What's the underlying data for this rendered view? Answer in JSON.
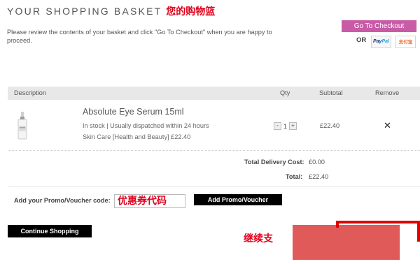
{
  "header": {
    "title": "YOUR SHOPPING BASKET",
    "title_cn": "您的购物篮",
    "intro": "Please review the contents of your basket and click \"Go To Checkout\" when you are happy to proceed."
  },
  "checkout": {
    "button_label": "Go To Checkout",
    "or_label": "OR",
    "paypal_part1": "Pay",
    "paypal_part2": "Pal",
    "alipay_label": "支付宝"
  },
  "table": {
    "columns": {
      "description": "Description",
      "qty": "Qty",
      "subtotal": "Subtotal",
      "remove": "Remove"
    },
    "items": [
      {
        "name": "Absolute Eye Serum 15ml",
        "stock": "In stock | Usually dispatched within 24 hours",
        "category": "Skin Care [Health and Beauty] £22.40",
        "qty_minus": "-",
        "qty": "1",
        "qty_plus": "+",
        "subtotal": "£22.40",
        "remove": "✕"
      }
    ]
  },
  "totals": {
    "delivery_label": "Total Delivery Cost:",
    "delivery_value": "£0.00",
    "total_label": "Total:",
    "total_value": "£22.40"
  },
  "promo": {
    "label": "Add your Promo/Voucher code:",
    "input_value_cn": "优惠券代码",
    "button_label": "Add Promo/Voucher"
  },
  "footer": {
    "continue_label": "Continue Shopping",
    "continue_cn": "继续支"
  },
  "colors": {
    "checkout": "#c95ba6",
    "annotation_red": "#e0001a",
    "block_red": "#e05a5a"
  }
}
